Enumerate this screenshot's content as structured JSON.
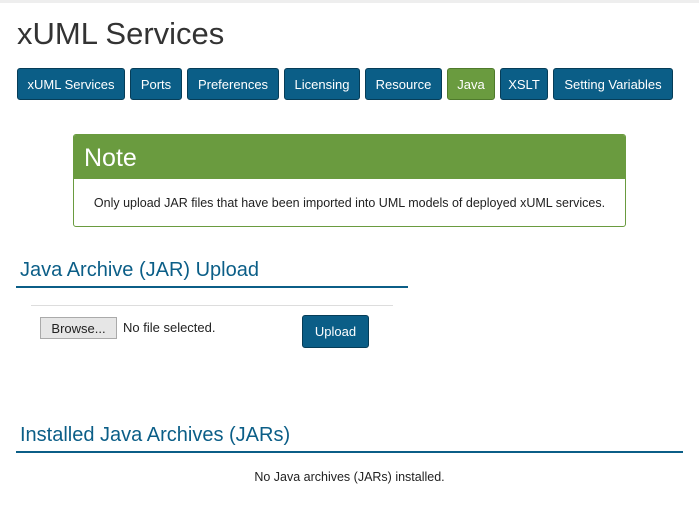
{
  "page_title": "xUML Services",
  "tabs": [
    {
      "label": "xUML Services"
    },
    {
      "label": "Ports"
    },
    {
      "label": "Preferences"
    },
    {
      "label": "Licensing"
    },
    {
      "label": "Resource"
    },
    {
      "label": "Java",
      "active": true
    },
    {
      "label": "XSLT"
    },
    {
      "label": "Setting Variables"
    }
  ],
  "note": {
    "title": "Note",
    "text": "Only upload JAR files that have been imported into UML models of deployed xUML services."
  },
  "upload": {
    "heading": "Java Archive (JAR) Upload",
    "browse_label": "Browse...",
    "file_status": "No file selected.",
    "upload_label": "Upload"
  },
  "installed": {
    "heading": "Installed Java Archives (JARs)",
    "empty_text": "No Java archives (JARs) installed."
  },
  "colors": {
    "primary": "#0b5e87",
    "accent": "#6a9b3f"
  }
}
